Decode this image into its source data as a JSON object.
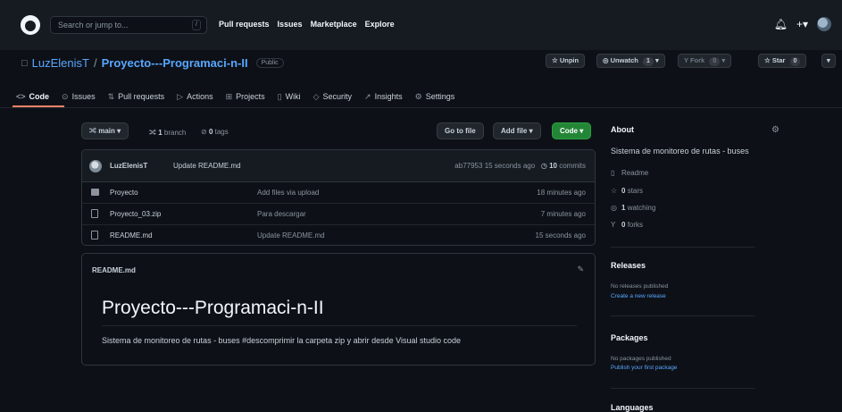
{
  "header": {
    "search_placeholder": "Search or jump to...",
    "search_key": "/",
    "nav": [
      "Pull requests",
      "Issues",
      "Marketplace",
      "Explore"
    ],
    "icons": [
      "bell-icon",
      "plus-icon",
      "avatar"
    ]
  },
  "repo": {
    "owner": "LuzElenisT",
    "separator": "/",
    "name": "Proyecto---Programaci-n-II",
    "visibility": "Public",
    "unpin_label": "Unpin",
    "unwatch_label": "Unwatch",
    "unwatch_count": "1",
    "fork_label": "Fork",
    "fork_count": "0",
    "star_label": "Star",
    "star_count": "0"
  },
  "tabs": [
    {
      "label": "Code",
      "icon": "code-icon"
    },
    {
      "label": "Issues",
      "icon": "issue-icon"
    },
    {
      "label": "Pull requests",
      "icon": "pull-request-icon"
    },
    {
      "label": "Actions",
      "icon": "play-icon"
    },
    {
      "label": "Projects",
      "icon": "table-icon"
    },
    {
      "label": "Wiki",
      "icon": "book-icon"
    },
    {
      "label": "Security",
      "icon": "shield-icon"
    },
    {
      "label": "Insights",
      "icon": "graph-icon"
    },
    {
      "label": "Settings",
      "icon": "gear-icon"
    }
  ],
  "filenav": {
    "branch": "main",
    "branch_count": "1",
    "branch_word": "branch",
    "tag_count": "0",
    "tag_word": "tags",
    "go_to_file": "Go to file",
    "add_file": "Add file",
    "code_button": "Code"
  },
  "commit": {
    "author": "LuzElenisT",
    "message": "Update README.md",
    "hash": "ab77953",
    "age": "15 seconds ago",
    "commit_count": "10",
    "commit_word": "commits"
  },
  "files": [
    {
      "name": "Proyecto",
      "type": "dir",
      "message": "Add files via upload",
      "age": "18 minutes ago"
    },
    {
      "name": "Proyecto_03.zip",
      "type": "file",
      "message": "Para descargar",
      "age": "7 minutes ago"
    },
    {
      "name": "README.md",
      "type": "file",
      "message": "Update README.md",
      "age": "15 seconds ago"
    }
  ],
  "readme": {
    "filename": "README.md",
    "title": "Proyecto---Programaci-n-II",
    "body": "Sistema de monitoreo de rutas - buses #descomprimir la carpeta zip y abrir desde Visual studio code"
  },
  "sidebar": {
    "about_heading": "About",
    "description": "Sistema de monitoreo de rutas - buses",
    "readme_label": "Readme",
    "stars_count": "0",
    "stars_word": "stars",
    "watching_count": "1",
    "watching_word": "watching",
    "forks_count": "0",
    "forks_word": "forks",
    "releases_heading": "Releases",
    "releases_none": "No releases published",
    "releases_link": "Create a new release",
    "packages_heading": "Packages",
    "packages_none": "No packages published",
    "packages_link": "Publish your first package",
    "languages_heading": "Languages"
  },
  "colors": {
    "background": "#0d1117",
    "header": "#161b22",
    "link": "#58a6ff",
    "green_button": "#238636",
    "tab_underline": "#f78166"
  }
}
